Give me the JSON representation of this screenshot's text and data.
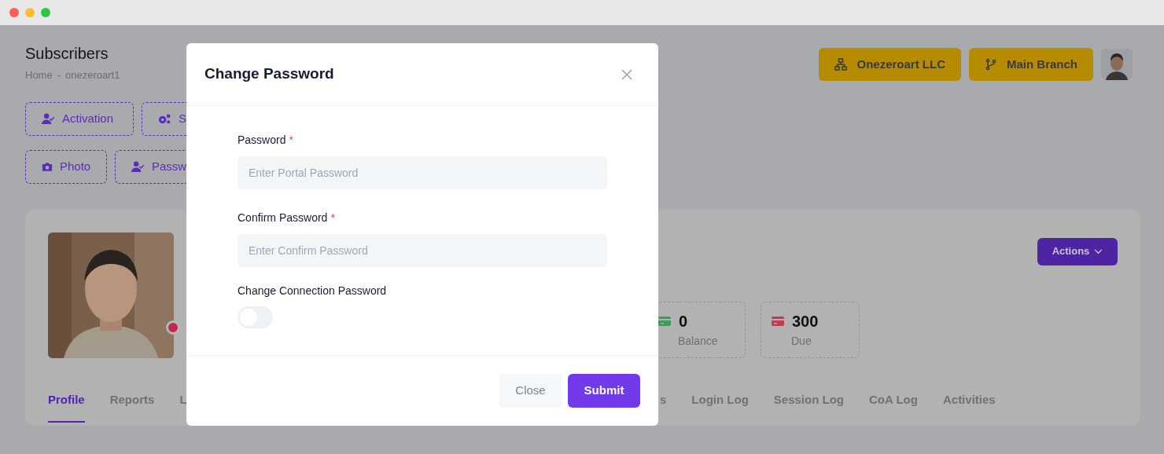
{
  "page": {
    "title": "Subscribers",
    "breadcrumb": [
      "Home",
      "-",
      "onezeroart1"
    ]
  },
  "header_buttons": [
    {
      "label": "Onezeroart LLC",
      "kind": "network"
    },
    {
      "label": "Main Branch",
      "kind": "branch"
    }
  ],
  "action_rows": [
    [
      {
        "label": "Activation",
        "kind": "user-check"
      },
      {
        "label": "S",
        "kind": "gears"
      }
    ],
    [
      {
        "label": "Photo",
        "kind": "camera"
      },
      {
        "label": "Passw",
        "kind": "user-check"
      }
    ]
  ],
  "profile": {
    "status_dot": {
      "color": "#c0284e"
    },
    "actions_label": "Actions",
    "stats": [
      {
        "value": "0",
        "label": "Balance",
        "color": "#3d9b5e"
      },
      {
        "value": "300",
        "label": "Due",
        "color": "#c23a52"
      }
    ]
  },
  "tabs": [
    {
      "label": "Profile",
      "selected": true
    },
    {
      "label": "Reports",
      "selected": false
    },
    {
      "label": "L",
      "selected": false
    },
    {
      "label": "s",
      "selected": false
    },
    {
      "label": "Login Log",
      "selected": false
    },
    {
      "label": "Session Log",
      "selected": false
    },
    {
      "label": "CoA Log",
      "selected": false
    },
    {
      "label": "Activities",
      "selected": false
    }
  ],
  "modal": {
    "title": "Change Password",
    "fields": [
      {
        "label": "Password",
        "required_mark": "*",
        "placeholder": "Enter Portal Password"
      },
      {
        "label": "Confirm Password",
        "required_mark": "*",
        "placeholder": "Enter Confirm Password"
      }
    ],
    "toggle": {
      "label": "Change Connection Password",
      "on": false
    },
    "buttons": [
      {
        "label": "Close",
        "kind": "secondary"
      },
      {
        "label": "Submit",
        "kind": "primary"
      }
    ]
  }
}
